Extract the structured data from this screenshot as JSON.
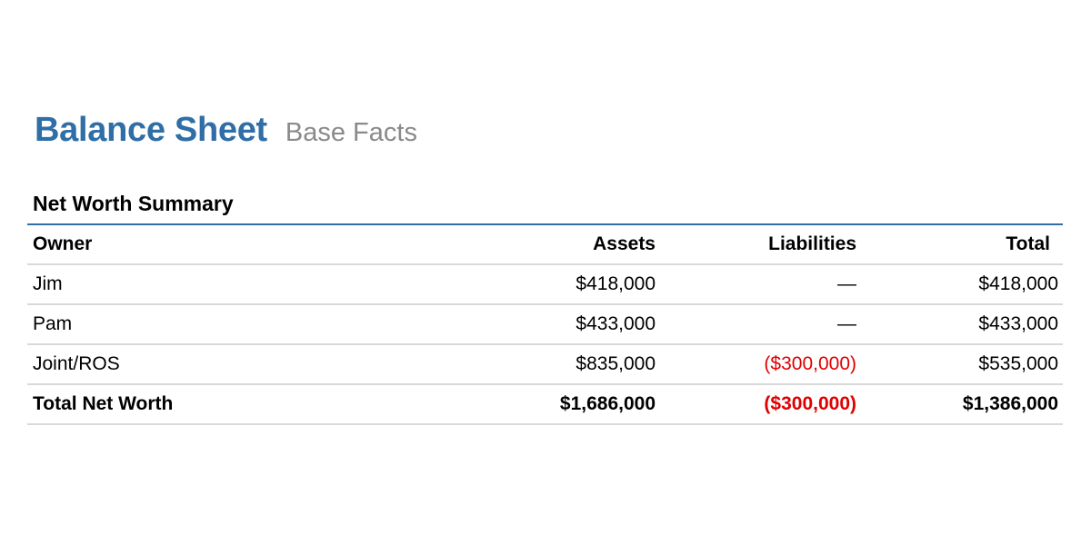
{
  "header": {
    "title": "Balance Sheet",
    "subtitle": "Base Facts"
  },
  "section": {
    "title": "Net Worth Summary"
  },
  "table": {
    "columns": [
      "Owner",
      "Assets",
      "Liabilities",
      "Total"
    ],
    "rows": [
      {
        "owner": "Jim",
        "assets": "$418,000",
        "liabilities": "—",
        "total": "$418,000"
      },
      {
        "owner": "Pam",
        "assets": "$433,000",
        "liabilities": "—",
        "total": "$433,000"
      },
      {
        "owner": "Joint/ROS",
        "assets": "$835,000",
        "liabilities": "($300,000)",
        "total": "$535,000"
      }
    ],
    "totals": {
      "owner": "Total Net Worth",
      "assets": "$1,686,000",
      "liabilities": "($300,000)",
      "total": "$1,386,000"
    }
  },
  "colors": {
    "accent": "#2f6ea6",
    "subtitle": "#8a8a8a",
    "negative": "#e00000",
    "rule": "#d9d9d9"
  }
}
